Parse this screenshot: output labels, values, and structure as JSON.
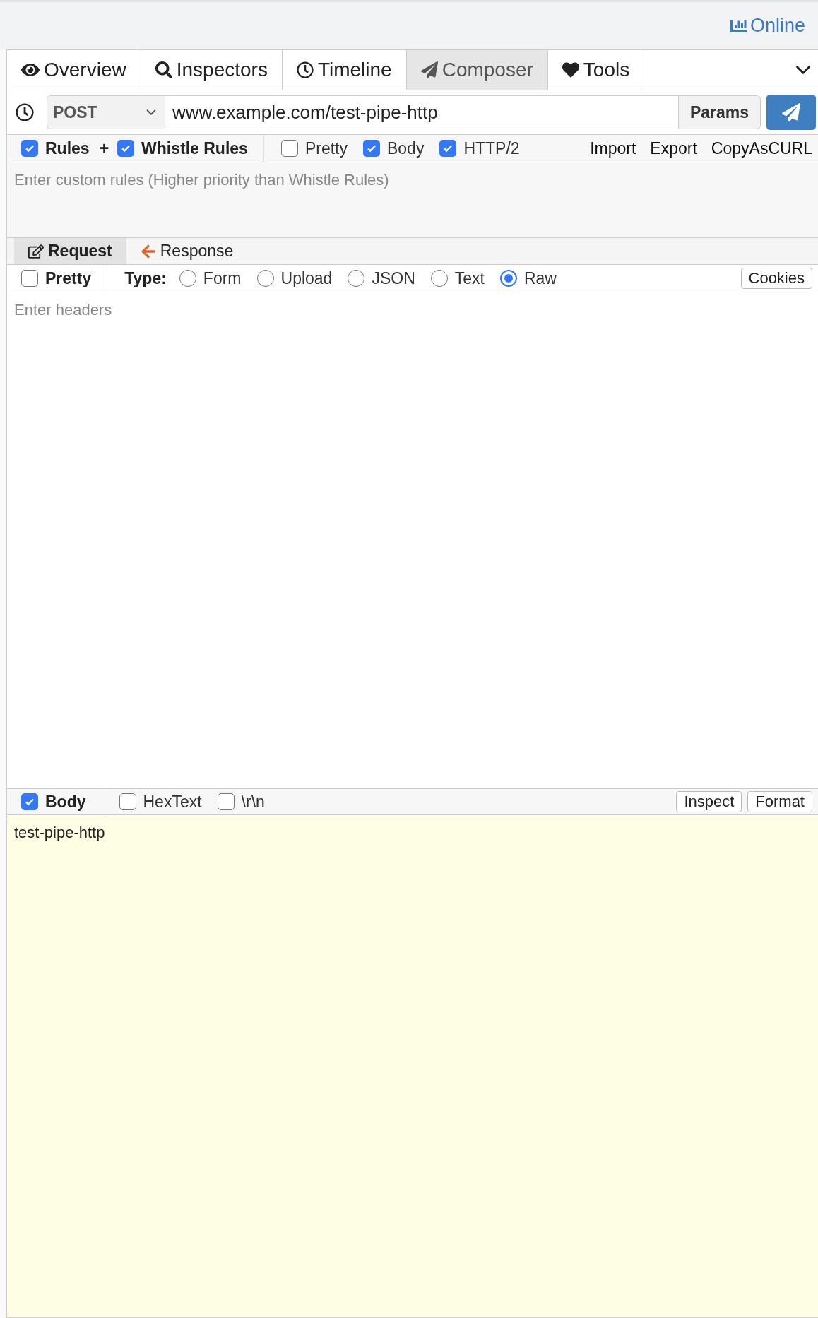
{
  "status": {
    "label": "Online"
  },
  "tabs": [
    {
      "label": "Overview",
      "selected": false
    },
    {
      "label": "Inspectors",
      "selected": false
    },
    {
      "label": "Timeline",
      "selected": false
    },
    {
      "label": "Composer",
      "selected": true
    },
    {
      "label": "Tools",
      "selected": false
    }
  ],
  "request_line": {
    "method": "POST",
    "url": "www.example.com/test-pipe-http",
    "params_button": "Params"
  },
  "options": [
    {
      "label": "Rules",
      "checked": true,
      "suffix": "+"
    },
    {
      "label": "Whistle Rules",
      "checked": true
    },
    {
      "label": "Pretty",
      "checked": false
    },
    {
      "label": "Body",
      "checked": true
    },
    {
      "label": "HTTP/2",
      "checked": true
    }
  ],
  "actions": [
    "Import",
    "Export",
    "CopyAsCURL"
  ],
  "rules": {
    "placeholder": "Enter custom rules (Higher priority than Whistle Rules)"
  },
  "subtabs": [
    {
      "label": "Request",
      "selected": true
    },
    {
      "label": "Response",
      "selected": false
    }
  ],
  "headers_bar": {
    "pretty": {
      "label": "Pretty",
      "checked": false
    },
    "type_label": "Type:",
    "types": [
      {
        "label": "Form",
        "selected": false
      },
      {
        "label": "Upload",
        "selected": false
      },
      {
        "label": "JSON",
        "selected": false
      },
      {
        "label": "Text",
        "selected": false
      },
      {
        "label": "Raw",
        "selected": true
      }
    ],
    "cookies_button": "Cookies"
  },
  "headers": {
    "placeholder": "Enter headers"
  },
  "body_bar": {
    "options": [
      {
        "label": "Body",
        "checked": true
      },
      {
        "label": "HexText",
        "checked": false
      },
      {
        "label": "\\r\\n",
        "checked": false
      }
    ],
    "buttons": [
      "Inspect",
      "Format"
    ]
  },
  "body": {
    "value": "test-pipe-http"
  }
}
